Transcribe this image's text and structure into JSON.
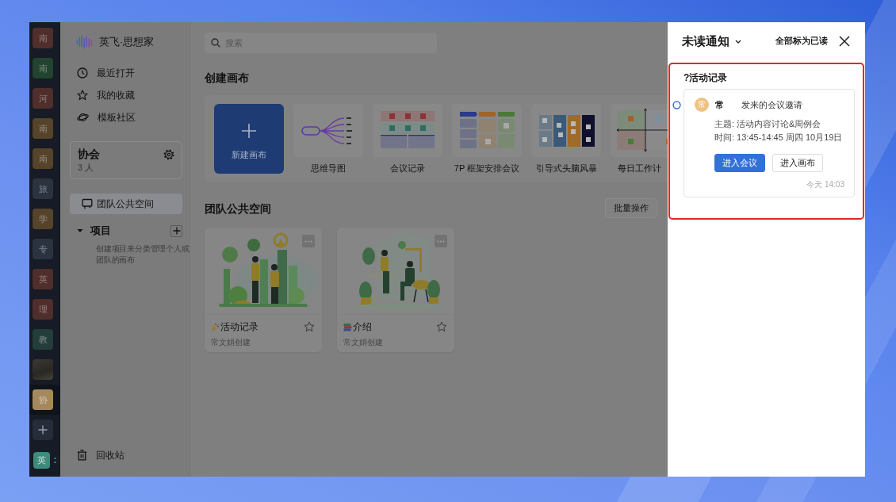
{
  "rail": {
    "workspaces": [
      {
        "kind": "letter",
        "label": "南",
        "color": "#4f2e2b",
        "selected": false
      },
      {
        "kind": "letter",
        "label": "南",
        "color": "#21432f",
        "selected": false
      },
      {
        "kind": "letter",
        "label": "河",
        "color": "#4f2e2b",
        "selected": false
      },
      {
        "kind": "letter",
        "label": "南",
        "color": "#55432a",
        "selected": false
      },
      {
        "kind": "letter",
        "label": "南",
        "color": "#55432a",
        "selected": false
      },
      {
        "kind": "letter",
        "label": "旅",
        "color": "#2b3240",
        "selected": false
      },
      {
        "kind": "letter",
        "label": "学",
        "color": "#55432a",
        "selected": false
      },
      {
        "kind": "letter",
        "label": "专",
        "color": "#2b3240",
        "selected": false
      },
      {
        "kind": "letter",
        "label": "英",
        "color": "#4f2e2b",
        "selected": false
      },
      {
        "kind": "letter",
        "label": "理",
        "color": "#4f2e2b",
        "selected": false
      },
      {
        "kind": "letter",
        "label": "教",
        "color": "#233d3a",
        "selected": false
      },
      {
        "kind": "photo",
        "selected": false
      },
      {
        "kind": "letter",
        "label": "协",
        "color": "#a5895e",
        "selected": true
      }
    ],
    "user": {
      "initial": "英"
    }
  },
  "sidebar": {
    "logo": "英飞·思想家",
    "nav": [
      {
        "label": "最近打开"
      },
      {
        "label": "我的收藏"
      },
      {
        "label": "模板社区"
      }
    ],
    "team": {
      "name": "协会",
      "members": "3 人"
    },
    "spaces": [
      {
        "label": "团队公共空间",
        "selected": true
      }
    ],
    "projects": {
      "label": "项目",
      "expanded": true,
      "hint": "创建项目来分类管理个人或团队的画布"
    },
    "trash": "回收站"
  },
  "main": {
    "search": {
      "placeholder": "搜索"
    },
    "create": {
      "title": "创建画布",
      "new_canvas": "新建画布",
      "templates": [
        {
          "kind": "mindmap",
          "label": "思维导图"
        },
        {
          "kind": "minutes",
          "label": "会议记录"
        },
        {
          "kind": "framework",
          "label": "7P 框架安排会议"
        },
        {
          "kind": "brainstorm",
          "label": "引导式头脑风暴"
        },
        {
          "kind": "matrix",
          "label": "每日工作计"
        }
      ]
    },
    "team_space": {
      "title": "团队公共空间",
      "batch_button": "批量操作",
      "boards": [
        {
          "kind": "party",
          "title": "活动记录",
          "author": "常文娟创建",
          "starred": false
        },
        {
          "kind": "books",
          "title": "介绍",
          "author": "常文娟创建",
          "starred": false
        }
      ]
    }
  },
  "notifications": {
    "title": "未读通知",
    "mark_all": "全部标为已读",
    "groups": [
      {
        "board": "?活动记录",
        "highlighted": true,
        "items": [
          {
            "unread": true,
            "avatar": "常",
            "sender": "常",
            "action": "发来的会议邀请",
            "topic": "主题: 活动内容讨论&周例会",
            "time": "时间: 13:45-14:45 周四 10月19日",
            "buttons": [
              {
                "label": "进入会议",
                "primary": true
              },
              {
                "label": "进入画布",
                "primary": false
              }
            ],
            "timestamp": "今天 14:03"
          }
        ]
      }
    ]
  }
}
